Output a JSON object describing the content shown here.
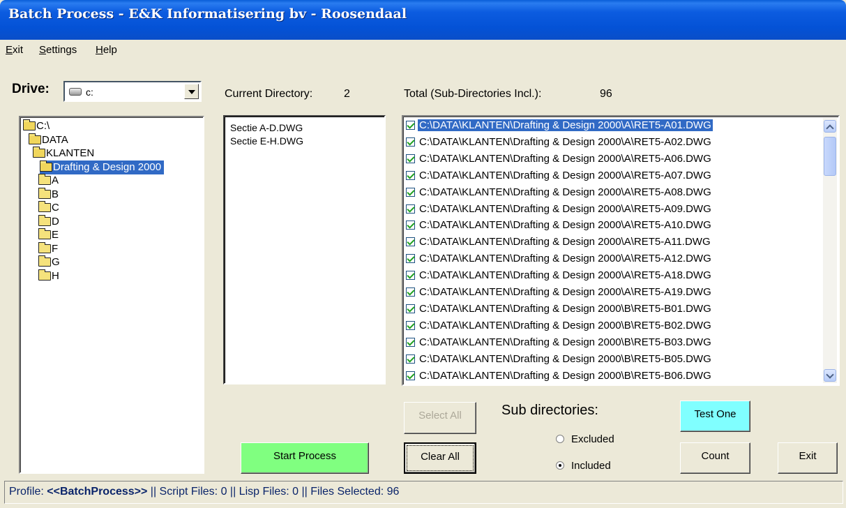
{
  "window": {
    "title": "Batch Process - E&K Informatisering bv - Roosendaal"
  },
  "menu": [
    {
      "label": "Exit",
      "accel": "E"
    },
    {
      "label": "Settings",
      "accel": "S"
    },
    {
      "label": "Help",
      "accel": "H"
    }
  ],
  "drive": {
    "label": "Drive:",
    "value": "c:"
  },
  "tree": {
    "items": [
      {
        "label": "C:\\",
        "icon": "open-folder-icon",
        "selected": false
      },
      {
        "label": "DATA",
        "icon": "open-folder-icon",
        "selected": false
      },
      {
        "label": "KLANTEN",
        "icon": "open-folder-icon",
        "selected": false
      },
      {
        "label": "Drafting & Design 2000",
        "icon": "open-folder-icon",
        "selected": true
      },
      {
        "label": "A",
        "icon": "folder-icon",
        "selected": false
      },
      {
        "label": "B",
        "icon": "folder-icon",
        "selected": false
      },
      {
        "label": "C",
        "icon": "folder-icon",
        "selected": false
      },
      {
        "label": "D",
        "icon": "folder-icon",
        "selected": false
      },
      {
        "label": "E",
        "icon": "folder-icon",
        "selected": false
      },
      {
        "label": "F",
        "icon": "folder-icon",
        "selected": false
      },
      {
        "label": "G",
        "icon": "folder-icon",
        "selected": false
      },
      {
        "label": "H",
        "icon": "folder-icon",
        "selected": false
      }
    ]
  },
  "current_directory": {
    "label": "Current Directory:",
    "count": "2",
    "files": [
      "Sectie A-D.DWG",
      "Sectie E-H.DWG"
    ]
  },
  "total": {
    "label": "Total  (Sub-Directories Incl.):",
    "count": "96"
  },
  "checklist": {
    "items": [
      {
        "path": "C:\\DATA\\KLANTEN\\Drafting & Design 2000\\A\\RET5-A01.DWG",
        "checked": true,
        "selected": true
      },
      {
        "path": "C:\\DATA\\KLANTEN\\Drafting & Design 2000\\A\\RET5-A02.DWG",
        "checked": true,
        "selected": false
      },
      {
        "path": "C:\\DATA\\KLANTEN\\Drafting & Design 2000\\A\\RET5-A06.DWG",
        "checked": true,
        "selected": false
      },
      {
        "path": "C:\\DATA\\KLANTEN\\Drafting & Design 2000\\A\\RET5-A07.DWG",
        "checked": true,
        "selected": false
      },
      {
        "path": "C:\\DATA\\KLANTEN\\Drafting & Design 2000\\A\\RET5-A08.DWG",
        "checked": true,
        "selected": false
      },
      {
        "path": "C:\\DATA\\KLANTEN\\Drafting & Design 2000\\A\\RET5-A09.DWG",
        "checked": true,
        "selected": false
      },
      {
        "path": "C:\\DATA\\KLANTEN\\Drafting & Design 2000\\A\\RET5-A10.DWG",
        "checked": true,
        "selected": false
      },
      {
        "path": "C:\\DATA\\KLANTEN\\Drafting & Design 2000\\A\\RET5-A11.DWG",
        "checked": true,
        "selected": false
      },
      {
        "path": "C:\\DATA\\KLANTEN\\Drafting & Design 2000\\A\\RET5-A12.DWG",
        "checked": true,
        "selected": false
      },
      {
        "path": "C:\\DATA\\KLANTEN\\Drafting & Design 2000\\A\\RET5-A18.DWG",
        "checked": true,
        "selected": false
      },
      {
        "path": "C:\\DATA\\KLANTEN\\Drafting & Design 2000\\A\\RET5-A19.DWG",
        "checked": true,
        "selected": false
      },
      {
        "path": "C:\\DATA\\KLANTEN\\Drafting & Design 2000\\B\\RET5-B01.DWG",
        "checked": true,
        "selected": false
      },
      {
        "path": "C:\\DATA\\KLANTEN\\Drafting & Design 2000\\B\\RET5-B02.DWG",
        "checked": true,
        "selected": false
      },
      {
        "path": "C:\\DATA\\KLANTEN\\Drafting & Design 2000\\B\\RET5-B03.DWG",
        "checked": true,
        "selected": false
      },
      {
        "path": "C:\\DATA\\KLANTEN\\Drafting & Design 2000\\B\\RET5-B05.DWG",
        "checked": true,
        "selected": false
      },
      {
        "path": "C:\\DATA\\KLANTEN\\Drafting & Design 2000\\B\\RET5-B06.DWG",
        "checked": true,
        "selected": false
      }
    ]
  },
  "buttons": {
    "select_all": "Select All",
    "start_process": "Start Process",
    "clear_all": "Clear All",
    "test_one": "Test One",
    "count": "Count",
    "exit": "Exit"
  },
  "subdirectories": {
    "label": "Sub directories:",
    "options": [
      {
        "label": "Excluded",
        "checked": false
      },
      {
        "label": "Included",
        "checked": true
      }
    ]
  },
  "status": {
    "prefix": "Profile: ",
    "profile": "<<BatchProcess>>",
    "rest": " || Script Files: 0 || Lisp Files: 0 || Files Selected: 96"
  },
  "colors": {
    "title_bar": "#0452d6",
    "selection": "#316ac5",
    "start_button": "#80ff80",
    "test_button": "#80ffff",
    "status_text": "#0a246a"
  }
}
